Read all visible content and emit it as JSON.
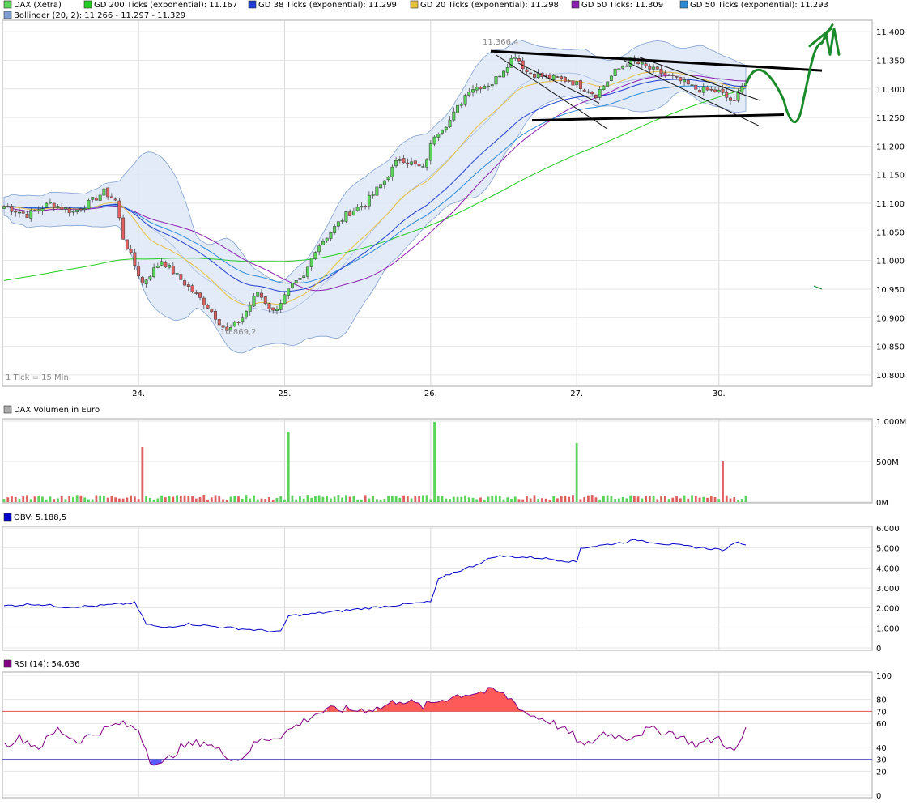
{
  "colors": {
    "price_up": "#5ad45a",
    "price_down": "#e06060",
    "gd200": "#22cc22",
    "gd38": "#1f3fd0",
    "gd20": "#e8c040",
    "gd50": "#8a1fb0",
    "gd50exp": "#2a8ad8",
    "bollinger": "#7f9fd0",
    "obv": "#0000cc",
    "rsi": "#800080",
    "rsi_fill_high": "#ff5a5a",
    "rsi_fill_low": "#5a5aff",
    "rsi_level_70": "#e05050",
    "rsi_level_30": "#5050c0",
    "annotation_black": "#000000",
    "annotation_green": "#1a8a2a"
  },
  "chart_data": [
    {
      "type": "candlestick",
      "panel": "price",
      "legend": [
        {
          "label": "DAX (Xetra)",
          "color": "#5ad45a"
        },
        {
          "label": "GD 200 Ticks (exponential): 11.167",
          "color": "#22cc22"
        },
        {
          "label": "GD 38 Ticks (exponential): 11.299",
          "color": "#1f3fd0"
        },
        {
          "label": "GD 20 Ticks (exponential): 11.298",
          "color": "#e8c040"
        },
        {
          "label": "GD 50 Ticks: 11.309",
          "color": "#8a1fb0"
        },
        {
          "label": "GD 50 Ticks (exponential): 11.293",
          "color": "#2a8ad8"
        },
        {
          "label": "Bollinger (20, 2): 11.266 - 11.297 - 11.329",
          "color": "#7f9fd0"
        }
      ],
      "x_ticks": [
        "24.",
        "25.",
        "26.",
        "27.",
        "30."
      ],
      "y_ticks": [
        "11.400",
        "11.350",
        "11.300",
        "11.250",
        "11.200",
        "11.150",
        "11.100",
        "11.050",
        "11.000",
        "10.950",
        "10.900",
        "10.850",
        "10.800"
      ],
      "ylim": [
        10.78,
        11.42
      ],
      "annotations": [
        "11.366,4",
        "10.869,2",
        "1 Tick = 15 Min."
      ],
      "close_keypoints": [
        [
          0,
          11.095
        ],
        [
          6,
          11.08
        ],
        [
          12,
          11.1
        ],
        [
          18,
          11.085
        ],
        [
          22,
          11.1
        ],
        [
          26,
          11.12
        ],
        [
          29,
          11.105
        ],
        [
          31,
          11.04
        ],
        [
          36,
          10.96
        ],
        [
          41,
          11.0
        ],
        [
          47,
          10.96
        ],
        [
          53,
          10.92
        ],
        [
          58,
          10.875
        ],
        [
          62,
          10.9
        ],
        [
          66,
          10.945
        ],
        [
          70,
          10.91
        ],
        [
          75,
          10.955
        ],
        [
          78,
          10.97
        ],
        [
          81,
          11.02
        ],
        [
          85,
          11.05
        ],
        [
          89,
          11.08
        ],
        [
          94,
          11.1
        ],
        [
          99,
          11.14
        ],
        [
          103,
          11.18
        ],
        [
          109,
          11.16
        ],
        [
          112,
          11.22
        ],
        [
          116,
          11.245
        ],
        [
          121,
          11.3
        ],
        [
          127,
          11.31
        ],
        [
          133,
          11.36
        ],
        [
          136,
          11.33
        ],
        [
          141,
          11.32
        ],
        [
          147,
          11.315
        ],
        [
          150,
          11.305
        ],
        [
          154,
          11.29
        ],
        [
          159,
          11.33
        ],
        [
          163,
          11.35
        ],
        [
          168,
          11.335
        ],
        [
          174,
          11.32
        ],
        [
          180,
          11.3
        ],
        [
          186,
          11.295
        ],
        [
          190,
          11.275
        ],
        [
          192,
          11.31
        ]
      ],
      "last_close": 11.31
    },
    {
      "type": "bar",
      "panel": "volume",
      "title": "DAX Volumen in Euro",
      "y_ticks": [
        "1.000M",
        "500M",
        "0M"
      ],
      "ylim": [
        0,
        1000
      ],
      "spikes": [
        [
          36,
          680
        ],
        [
          74,
          870
        ],
        [
          112,
          990
        ],
        [
          149,
          730
        ],
        [
          187,
          510
        ]
      ],
      "base_level_range": [
        30,
        90
      ]
    },
    {
      "type": "line",
      "panel": "obv",
      "title": "OBV: 5.188,5",
      "y_ticks": [
        "6.000",
        "5.000",
        "4.000",
        "3.000",
        "2.000",
        "1.000",
        "0"
      ],
      "ylim": [
        0,
        6000
      ],
      "keypoints": [
        [
          0,
          2100
        ],
        [
          8,
          2200
        ],
        [
          16,
          2050
        ],
        [
          24,
          2100
        ],
        [
          34,
          2250
        ],
        [
          37,
          1200
        ],
        [
          41,
          1000
        ],
        [
          48,
          1200
        ],
        [
          56,
          1050
        ],
        [
          62,
          950
        ],
        [
          72,
          800
        ],
        [
          74,
          1600
        ],
        [
          80,
          1700
        ],
        [
          90,
          1900
        ],
        [
          100,
          2100
        ],
        [
          111,
          2300
        ],
        [
          113,
          3400
        ],
        [
          116,
          3700
        ],
        [
          122,
          4100
        ],
        [
          128,
          4600
        ],
        [
          140,
          4500
        ],
        [
          149,
          4300
        ],
        [
          150,
          5000
        ],
        [
          158,
          5200
        ],
        [
          165,
          5400
        ],
        [
          172,
          5200
        ],
        [
          182,
          5000
        ],
        [
          188,
          4900
        ],
        [
          190,
          5300
        ],
        [
          193,
          5188.5
        ]
      ]
    },
    {
      "type": "line",
      "panel": "rsi",
      "title": "RSI (14): 54,636",
      "y_ticks": [
        "100",
        "80",
        "70",
        "60",
        "40",
        "30",
        "20",
        "0"
      ],
      "ylim": [
        0,
        100
      ],
      "levels": [
        70,
        30
      ],
      "keypoints": [
        [
          0,
          42
        ],
        [
          4,
          48
        ],
        [
          9,
          40
        ],
        [
          14,
          55
        ],
        [
          19,
          45
        ],
        [
          24,
          52
        ],
        [
          30,
          60
        ],
        [
          35,
          55
        ],
        [
          38,
          30
        ],
        [
          41,
          25
        ],
        [
          46,
          40
        ],
        [
          52,
          45
        ],
        [
          57,
          35
        ],
        [
          61,
          29
        ],
        [
          66,
          45
        ],
        [
          72,
          50
        ],
        [
          77,
          60
        ],
        [
          81,
          68
        ],
        [
          86,
          72
        ],
        [
          92,
          71
        ],
        [
          98,
          73
        ],
        [
          103,
          80
        ],
        [
          109,
          74
        ],
        [
          114,
          80
        ],
        [
          119,
          84
        ],
        [
          124,
          86
        ],
        [
          128,
          87
        ],
        [
          132,
          80
        ],
        [
          136,
          68
        ],
        [
          142,
          62
        ],
        [
          148,
          50
        ],
        [
          151,
          40
        ],
        [
          156,
          52
        ],
        [
          162,
          48
        ],
        [
          168,
          55
        ],
        [
          174,
          52
        ],
        [
          180,
          42
        ],
        [
          186,
          48
        ],
        [
          190,
          35
        ],
        [
          193,
          54.6
        ]
      ]
    }
  ]
}
